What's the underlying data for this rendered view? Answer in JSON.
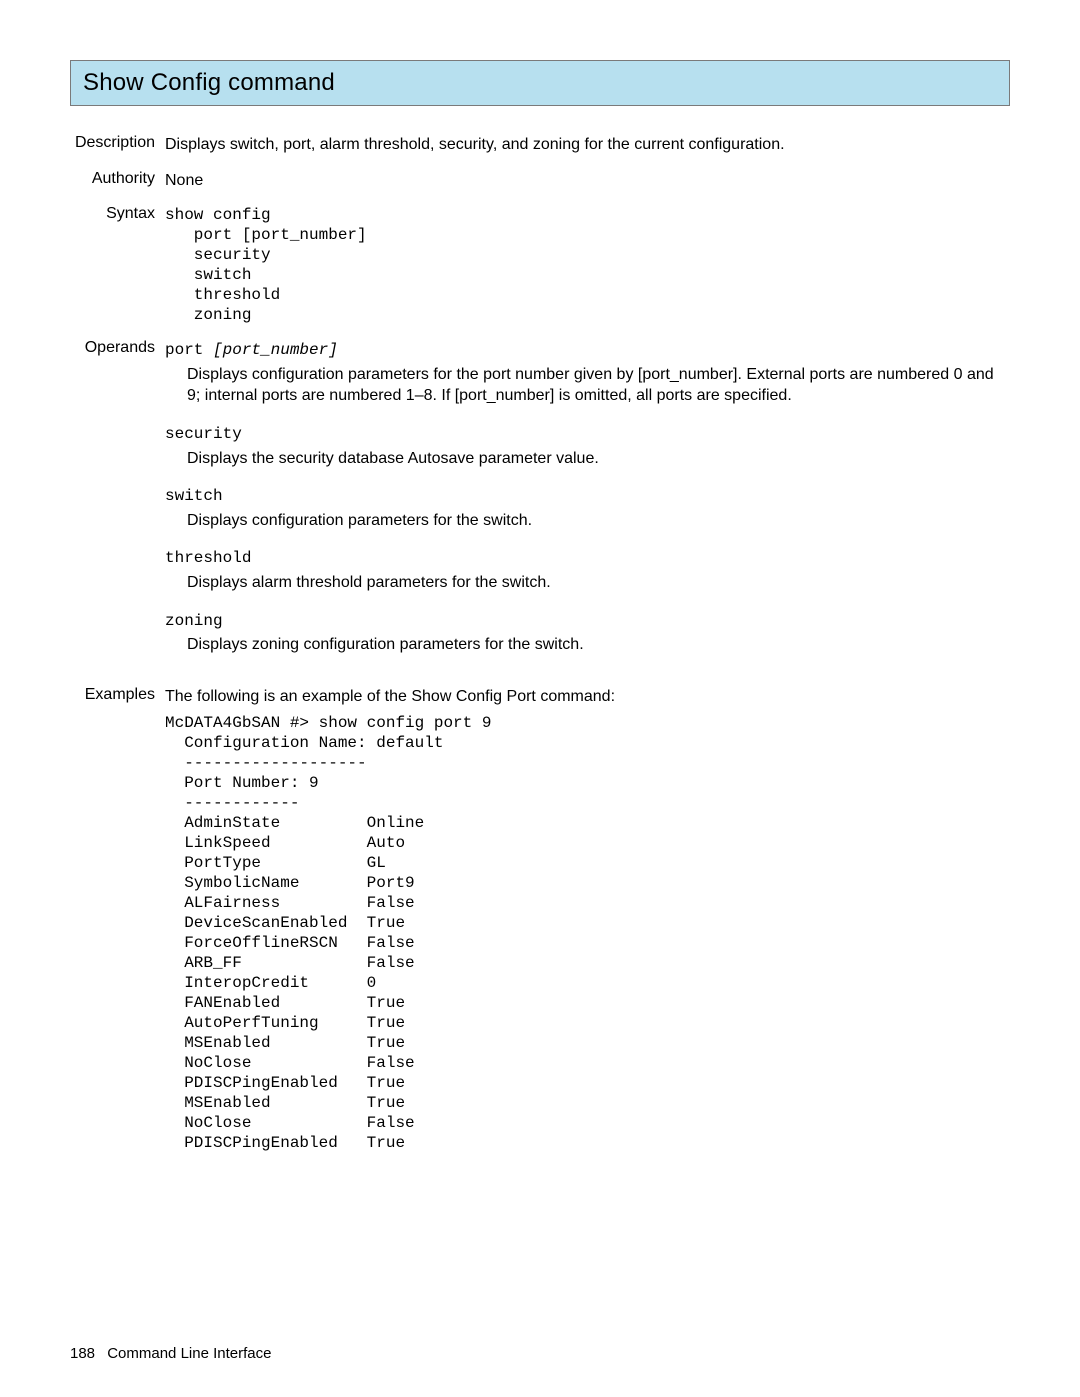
{
  "heading": "Show Config command",
  "labels": {
    "description": "Description",
    "authority": "Authority",
    "syntax": "Syntax",
    "operands": "Operands",
    "examples": "Examples"
  },
  "description_text": "Displays switch, port, alarm threshold, security, and zoning for the current configuration.",
  "authority_value": "None",
  "syntax_block": "show config\n   port [port_number]\n   security\n   switch\n   threshold\n   zoning",
  "operands": [
    {
      "code": "port ",
      "code_italic": "[port_number]",
      "desc": "Displays configuration parameters for the port number given by [port_number]. External ports are numbered 0 and 9; internal ports are numbered 1–8. If [port_number] is omitted, all ports are specified."
    },
    {
      "code": "security",
      "code_italic": "",
      "desc": "Displays the security database Autosave parameter value."
    },
    {
      "code": "switch",
      "code_italic": "",
      "desc": "Displays configuration parameters for the switch."
    },
    {
      "code": "threshold",
      "code_italic": "",
      "desc": "Displays alarm threshold parameters for the switch."
    },
    {
      "code": "zoning",
      "code_italic": "",
      "desc": "Displays zoning configuration parameters for the switch."
    }
  ],
  "examples_intro": "The following is an example of the Show Config Port command:",
  "example_output": "McDATA4GbSAN #> show config port 9\n  Configuration Name: default\n  -------------------\n  Port Number: 9\n  ------------\n  AdminState         Online\n  LinkSpeed          Auto\n  PortType           GL\n  SymbolicName       Port9\n  ALFairness         False\n  DeviceScanEnabled  True\n  ForceOfflineRSCN   False\n  ARB_FF             False\n  InteropCredit      0\n  FANEnabled         True\n  AutoPerfTuning     True\n  MSEnabled          True\n  NoClose            False\n  PDISCPingEnabled   True\n  MSEnabled          True\n  NoClose            False\n  PDISCPingEnabled   True",
  "footer": {
    "page_number": "188",
    "section": "Command Line Interface"
  }
}
